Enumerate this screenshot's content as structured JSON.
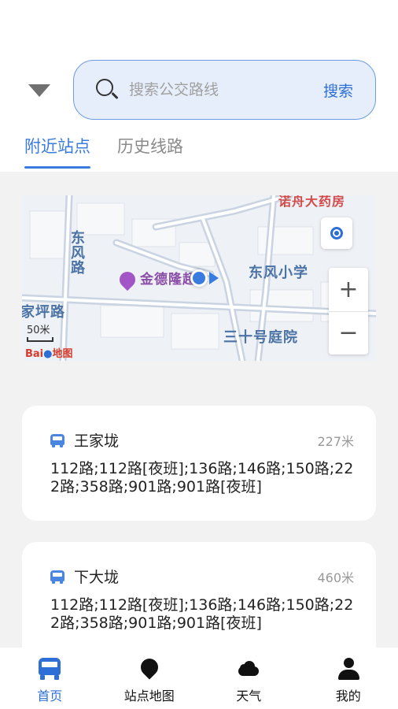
{
  "search": {
    "placeholder": "搜索公交路线",
    "button_label": "搜索"
  },
  "tabs": [
    {
      "label": "附近站点",
      "active": true
    },
    {
      "label": "历史线路",
      "active": false
    }
  ],
  "map": {
    "labels": {
      "dongfeng_road": "东风路",
      "jindelong": "金德隆超",
      "dongfeng_school": "东风小学",
      "sanshihao": "三十号庭院",
      "jiaping_road": "家坪路",
      "nuozhou": "诺舟大药房"
    },
    "scale_text": "50米",
    "logo_brand": "Bai",
    "logo_suffix": "地图",
    "zoom_in": "+",
    "zoom_out": "−"
  },
  "stations": [
    {
      "name": "王家垅",
      "distance": "227米",
      "routes": "112路;112路[夜班];136路;146路;150路;222路;358路;901路;901路[夜班]"
    },
    {
      "name": "下大垅",
      "distance": "460米",
      "routes": "112路;112路[夜班];136路;146路;150路;222路;358路;901路;901路[夜班]"
    }
  ],
  "nav": [
    {
      "label": "首页",
      "icon": "bus-icon",
      "active": true
    },
    {
      "label": "站点地图",
      "icon": "map-pin-icon",
      "active": false
    },
    {
      "label": "天气",
      "icon": "cloud-icon",
      "active": false
    },
    {
      "label": "我的",
      "icon": "user-icon",
      "active": false
    }
  ],
  "colors": {
    "accent": "#2d6fd6",
    "search_bg": "#e6eefb",
    "content_bg": "#f2f2f2"
  }
}
